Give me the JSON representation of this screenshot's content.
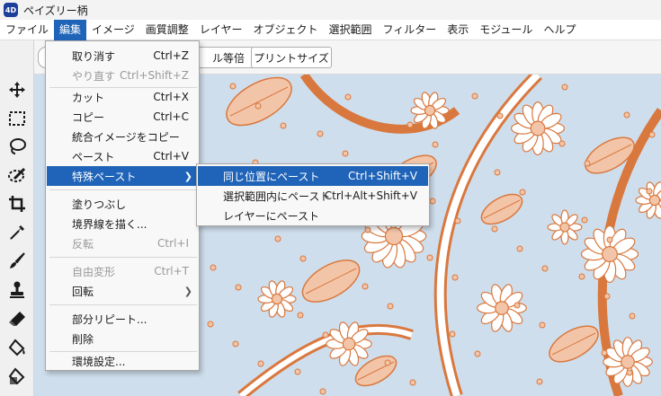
{
  "window": {
    "app_icon_text": "4D",
    "title": "ペイズリー柄"
  },
  "menubar": [
    {
      "label": "ファイル"
    },
    {
      "label": "編集"
    },
    {
      "label": "イメージ"
    },
    {
      "label": "画質調整"
    },
    {
      "label": "レイヤー"
    },
    {
      "label": "オブジェクト"
    },
    {
      "label": "選択範囲"
    },
    {
      "label": "フィルター"
    },
    {
      "label": "表示"
    },
    {
      "label": "モジュール"
    },
    {
      "label": "ヘルプ"
    }
  ],
  "options_bar": {
    "btn_equal": "ル等倍",
    "btn_print_size": "プリントサイズ"
  },
  "tools": [
    "move-icon",
    "marquee-icon",
    "lasso-icon",
    "magic-wand-icon",
    "crop-icon",
    "eyedropper-icon",
    "brush-icon",
    "stamp-icon",
    "eraser-icon",
    "paint-bucket-icon",
    "fill-icon"
  ],
  "edit_menu": [
    {
      "label": "取り消す",
      "shortcut": "Ctrl+Z",
      "disabled": false
    },
    {
      "label": "やり直す",
      "shortcut": "Ctrl+Shift+Z",
      "disabled": true
    },
    {
      "label": "カット",
      "shortcut": "Ctrl+X",
      "disabled": false
    },
    {
      "label": "コピー",
      "shortcut": "Ctrl+C",
      "disabled": false
    },
    {
      "label": "統合イメージをコピー",
      "shortcut": "",
      "disabled": false
    },
    {
      "label": "ペースト",
      "shortcut": "Ctrl+V",
      "disabled": false
    },
    {
      "label": "特殊ペースト",
      "shortcut": "",
      "disabled": false
    },
    {
      "label": "塗りつぶし",
      "shortcut": "",
      "disabled": false
    },
    {
      "label": "境界線を描く...",
      "shortcut": "",
      "disabled": false
    },
    {
      "label": "反転",
      "shortcut": "Ctrl+I",
      "disabled": true
    },
    {
      "label": "自由変形",
      "shortcut": "Ctrl+T",
      "disabled": true
    },
    {
      "label": "回転",
      "shortcut": "",
      "disabled": false
    },
    {
      "label": "部分リピート...",
      "shortcut": "",
      "disabled": false
    },
    {
      "label": "削除",
      "shortcut": "",
      "disabled": false
    },
    {
      "label": "環境設定...",
      "shortcut": "",
      "disabled": false
    }
  ],
  "paste_special_submenu": [
    {
      "label": "同じ位置にペースト",
      "shortcut": "Ctrl+Shift+V"
    },
    {
      "label": "選択範囲内にペースト",
      "shortcut": "Ctrl+Alt+Shift+V"
    },
    {
      "label": "レイヤーにペースト",
      "shortcut": ""
    }
  ],
  "colors": {
    "accent": "#1f64b8",
    "canvas_bg": "#cfdeec",
    "pattern_stroke": "#d9783e",
    "pattern_fill": "#f3c5a8",
    "pattern_white": "#ffffff"
  }
}
